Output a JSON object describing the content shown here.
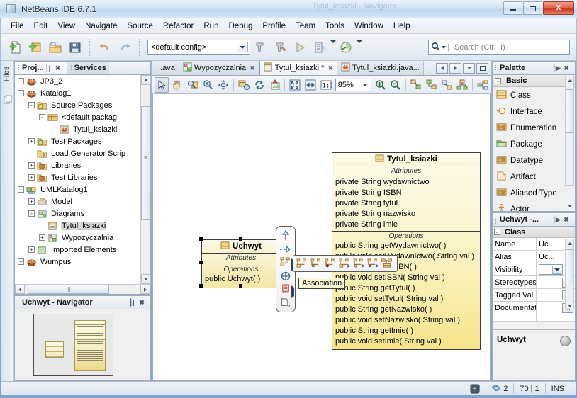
{
  "window": {
    "title": "NetBeans IDE 6.7.1",
    "title_icon": "netbeans-cube-icon",
    "ghost_text": "Tytul_ksiazki - Navigator",
    "minimize_label": "Minimize",
    "maximize_label": "Maximize",
    "close_label": "X"
  },
  "menubar": {
    "items": [
      {
        "label": "File",
        "mnemonic": "F"
      },
      {
        "label": "Edit",
        "mnemonic": "E"
      },
      {
        "label": "View",
        "mnemonic": "V"
      },
      {
        "label": "Navigate",
        "mnemonic": "N"
      },
      {
        "label": "Source",
        "mnemonic": "S"
      },
      {
        "label": "Refactor",
        "mnemonic": "c"
      },
      {
        "label": "Run",
        "mnemonic": "R"
      },
      {
        "label": "Debug",
        "mnemonic": "D"
      },
      {
        "label": "Profile",
        "mnemonic": "P"
      },
      {
        "label": "Team",
        "mnemonic": "m"
      },
      {
        "label": "Tools",
        "mnemonic": "T"
      },
      {
        "label": "Window",
        "mnemonic": "W"
      },
      {
        "label": "Help",
        "mnemonic": "H"
      }
    ]
  },
  "toolbar": {
    "icons": [
      "new-file-icon",
      "new-project-icon",
      "open-project-icon",
      "save-all-icon",
      "undo-icon",
      "redo-icon"
    ],
    "config_combo_value": "<default config>",
    "build_icons": [
      "build-project-icon",
      "clean-build-project-icon",
      "run-project-icon",
      "debug-project-icon",
      "profile-project-icon"
    ],
    "search_placeholder": "Search (Ctrl+I)",
    "search_icon": "search-icon"
  },
  "leftstrip": {
    "label": "Files",
    "icon": "files-icon"
  },
  "projects_panel": {
    "tabs": [
      {
        "label": "Proj...",
        "active": true,
        "name": "tab-projects"
      },
      {
        "label": "Services",
        "active": false,
        "name": "tab-services"
      }
    ],
    "minimize_glyph": "⎮|",
    "close_glyph": "✖",
    "tree": [
      {
        "indent": 0,
        "expander": "+",
        "icon": "java-project-icon",
        "label": "JP3_2",
        "selected": false
      },
      {
        "indent": 0,
        "expander": "-",
        "icon": "java-project-icon",
        "label": "Katalog1",
        "selected": false
      },
      {
        "indent": 1,
        "expander": "-",
        "icon": "source-packages-icon",
        "label": "Source Packages",
        "selected": false
      },
      {
        "indent": 2,
        "expander": "-",
        "icon": "package-icon",
        "label": "<default packag",
        "selected": false
      },
      {
        "indent": 3,
        "expander": "",
        "icon": "java-class-icon",
        "label": "Tytul_ksiazki",
        "selected": false
      },
      {
        "indent": 1,
        "expander": "+",
        "icon": "test-packages-icon",
        "label": "Test Packages",
        "selected": false
      },
      {
        "indent": 1,
        "expander": "",
        "icon": "load-generator-icon",
        "label": "Load Generator Scrip",
        "selected": false
      },
      {
        "indent": 1,
        "expander": "+",
        "icon": "libraries-icon",
        "label": "Libraries",
        "selected": false
      },
      {
        "indent": 1,
        "expander": "+",
        "icon": "libraries-icon",
        "label": "Test Libraries",
        "selected": false
      },
      {
        "indent": 0,
        "expander": "-",
        "icon": "uml-project-icon",
        "label": "UMLKatalog1",
        "selected": false
      },
      {
        "indent": 1,
        "expander": "+",
        "icon": "model-icon",
        "label": "Model",
        "selected": false
      },
      {
        "indent": 1,
        "expander": "-",
        "icon": "diagrams-icon",
        "label": "Diagrams",
        "selected": false
      },
      {
        "indent": 2,
        "expander": "",
        "icon": "class-diagram-icon",
        "label": "Tytul_ksiazki",
        "selected": true
      },
      {
        "indent": 2,
        "expander": "+",
        "icon": "uml-diagram-icon",
        "label": "Wypozyczalnia",
        "selected": false
      },
      {
        "indent": 1,
        "expander": "+",
        "icon": "imported-elements-icon",
        "label": "Imported Elements",
        "selected": false
      },
      {
        "indent": 0,
        "expander": "+",
        "icon": "java-project-icon",
        "label": "Wumpus",
        "selected": false
      }
    ]
  },
  "navigator_panel": {
    "title": "Uchwyt - Navigator",
    "minimize_glyph": "⎮|",
    "close_glyph": "✖"
  },
  "editor": {
    "tabs": [
      {
        "label": "...ava",
        "icon": "java-file-icon",
        "active": false,
        "closeable": false,
        "name": "tab-java-truncated"
      },
      {
        "label": "Wypozyczalnia",
        "icon": "uml-diagram-icon",
        "active": false,
        "closeable": true,
        "name": "tab-wypozyczalnia"
      },
      {
        "label": "Tytul_ksiazki *",
        "icon": "class-diagram-icon",
        "active": true,
        "closeable": true,
        "name": "tab-tytul-ksiazki-diagram"
      },
      {
        "label": "Tytul_ksiazki.java...",
        "icon": "java-file-icon",
        "active": false,
        "closeable": false,
        "name": "tab-tytul-ksiazki-java"
      }
    ],
    "tab_nav": [
      "scroll-left",
      "scroll-right",
      "tab-list-dropdown",
      "maximize-editor"
    ],
    "diagram_toolbar": {
      "icons": [
        "select-tool-icon",
        "pan-tool-icon",
        "zoom-region-icon",
        "zoom-tool-icon",
        "move-tool-icon",
        "show-hide-elements-icon",
        "refresh-icon",
        "export-image-icon",
        "fit-to-window-icon",
        "fit-width-icon",
        "actual-size-icon"
      ],
      "zoom_value": "85%",
      "zoom_in_icon": "zoom-in-icon",
      "zoom_out_icon": "zoom-out-icon",
      "layout_icons": [
        "layout-hierarchical-icon",
        "layout-orthogonal-icon",
        "layout-sequence-icon",
        "layout-tree-icon",
        "layout-auto-icon"
      ]
    }
  },
  "diagram": {
    "uchwyt": {
      "name": "Uchwyt",
      "icon": "class-icon",
      "attributes_label": "Attributes",
      "operations_label": "Operations",
      "attributes": [],
      "operations": [
        "public Uchwyt( )"
      ],
      "selected": true
    },
    "tytul_ksiazki": {
      "name": "Tytul_ksiazki",
      "icon": "class-icon",
      "attributes_label": "Attributes",
      "operations_label": "Operations",
      "attributes": [
        "private String wydawnictwo",
        "private String ISBN",
        "private String tytul",
        "private String nazwisko",
        "private String imie"
      ],
      "operations": [
        "public String getWydawnictwo( )",
        "public void  setWydawnictwo( String val )",
        "public String  getISBN( )",
        "public void  setISBN( String val )",
        "public String  getTytul( )",
        "public void  setTytul( String val )",
        "public String  getNazwisko( )",
        "public void  setNazwisko( String val )",
        "public String  getImie( )",
        "public void  setImie( String val )"
      ]
    },
    "tool_strip": [
      {
        "name": "generalization-tool",
        "icon": "generalization-arrow-icon",
        "has_flyout": false
      },
      {
        "name": "realization-tool",
        "icon": "realization-arrow-icon",
        "has_flyout": false
      },
      {
        "name": "association-tool",
        "icon": "association-icon",
        "has_flyout": true
      },
      {
        "name": "containment-tool",
        "icon": "containment-circle-icon",
        "has_flyout": false
      },
      {
        "name": "instance-tool",
        "icon": "instance-icon",
        "has_flyout": true
      },
      {
        "name": "comment-tool",
        "icon": "comment-link-icon",
        "has_flyout": false
      }
    ],
    "flyout": {
      "icons": [
        "association-plain-icon",
        "aggregation-icon",
        "composition-icon",
        "navigable-association-icon",
        "navigable-aggregation-icon",
        "navigable-composition-icon",
        "association-class-icon"
      ]
    },
    "tooltip": "Association"
  },
  "palette": {
    "title": "Palette",
    "minimize_glyph": "⎮▶",
    "close_glyph": "✖",
    "group": "Basic",
    "group_expander": "-",
    "items": [
      {
        "label": "Class",
        "icon": "class-icon"
      },
      {
        "label": "Interface",
        "icon": "interface-icon"
      },
      {
        "label": "Enumeration",
        "icon": "enumeration-icon"
      },
      {
        "label": "Package",
        "icon": "package-icon"
      },
      {
        "label": "Datatype",
        "icon": "datatype-icon"
      },
      {
        "label": "Artifact",
        "icon": "artifact-icon"
      },
      {
        "label": "Aliased Type",
        "icon": "aliased-type-icon"
      },
      {
        "label": "Actor",
        "icon": "actor-icon"
      }
    ]
  },
  "properties": {
    "title": "Uchwyt -...",
    "minimize_glyph": "⎮▶",
    "close_glyph": "✖",
    "group": "Class",
    "group_expander": "-",
    "rows": [
      {
        "name": "Name",
        "value": "Uc...",
        "type": "text"
      },
      {
        "name": "Alias",
        "value": "Uc...",
        "type": "text"
      },
      {
        "name": "Visibility",
        "value": "..",
        "type": "combo"
      },
      {
        "name": "Stereotypes",
        "value": "...",
        "type": "button"
      },
      {
        "name": "Tagged Valu",
        "value": "...",
        "type": "button"
      },
      {
        "name": "Documentat",
        "value": "...",
        "type": "button"
      }
    ],
    "footer_title": "Uchwyt"
  },
  "statusbar": {
    "cells": [
      {
        "text": "",
        "name": "status-git-icon"
      },
      {
        "text": "2",
        "name": "status-notification-count"
      },
      {
        "text": "70 | 1",
        "name": "status-caret-position"
      },
      {
        "text": "INS",
        "name": "status-insert-mode"
      }
    ]
  }
}
